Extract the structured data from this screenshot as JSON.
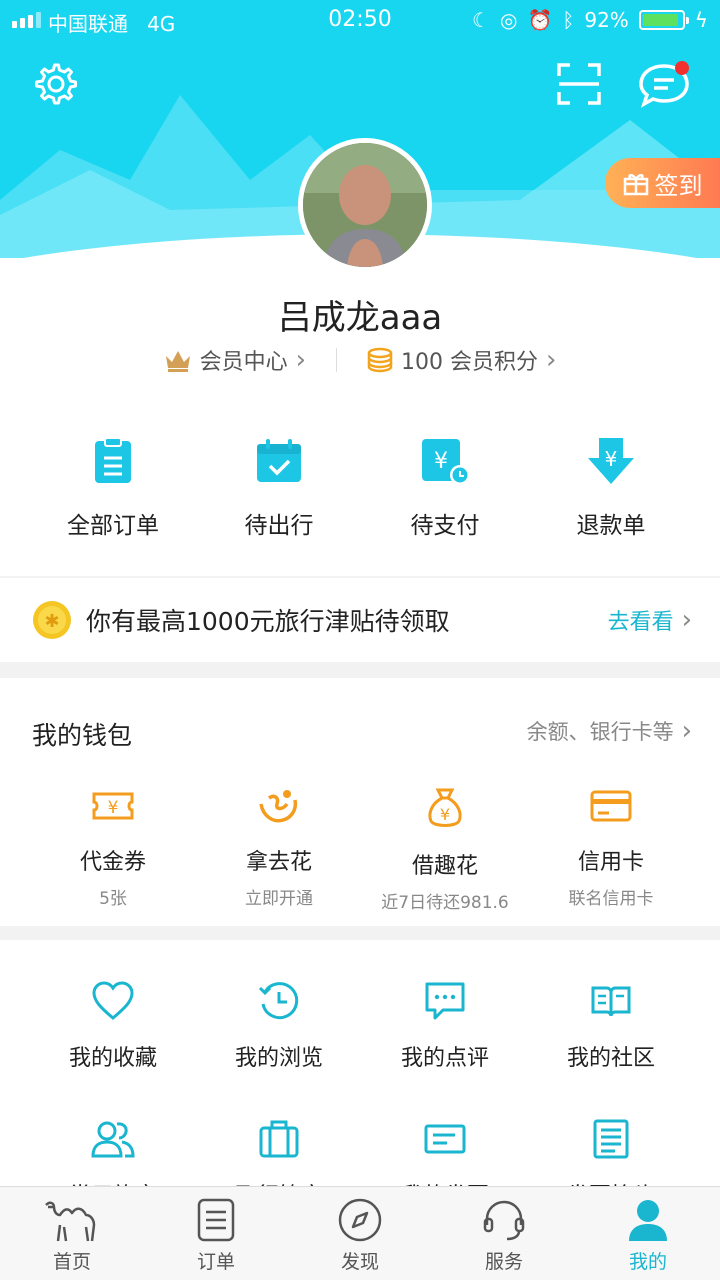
{
  "status_bar": {
    "carrier": "中国联通",
    "network": "4G",
    "time": "02:50",
    "battery": "92%"
  },
  "header": {
    "checkin_label": "签到"
  },
  "profile": {
    "username": "吕成龙aaa",
    "member_center": "会员中心",
    "points": "100 会员积分"
  },
  "orders": [
    {
      "label": "全部订单",
      "icon": "clipboard-icon"
    },
    {
      "label": "待出行",
      "icon": "calendar-check-icon"
    },
    {
      "label": "待支付",
      "icon": "yen-clock-icon"
    },
    {
      "label": "退款单",
      "icon": "refund-arrow-icon"
    }
  ],
  "promo": {
    "text": "你有最高1000元旅行津贴待领取",
    "link": "去看看"
  },
  "wallet": {
    "title": "我的钱包",
    "more": "余额、银行卡等",
    "items": [
      {
        "label": "代金券",
        "sub": "5张",
        "icon": "voucher-icon"
      },
      {
        "label": "拿去花",
        "sub": "立即开通",
        "icon": "nqh-icon"
      },
      {
        "label": "借趣花",
        "sub": "近7日待还981.6",
        "icon": "money-bag-icon"
      },
      {
        "label": "信用卡",
        "sub": "联名信用卡",
        "icon": "credit-card-icon"
      }
    ]
  },
  "services": {
    "row1": [
      {
        "label": "我的收藏",
        "icon": "heart-icon"
      },
      {
        "label": "我的浏览",
        "icon": "history-icon"
      },
      {
        "label": "我的点评",
        "icon": "comment-icon"
      },
      {
        "label": "我的社区",
        "icon": "book-icon"
      }
    ],
    "row2": [
      {
        "label": "常用旅客",
        "icon": "users-icon"
      },
      {
        "label": "飞行管家",
        "icon": "luggage-icon"
      },
      {
        "label": "我的发票",
        "icon": "ticket-icon"
      },
      {
        "label": "发票抬头",
        "icon": "invoice-icon"
      }
    ]
  },
  "tabs": [
    {
      "label": "首页",
      "icon": "camel-icon",
      "active": false
    },
    {
      "label": "订单",
      "icon": "order-list-icon",
      "active": false
    },
    {
      "label": "发现",
      "icon": "compass-icon",
      "active": false
    },
    {
      "label": "服务",
      "icon": "headset-icon",
      "active": false
    },
    {
      "label": "我的",
      "icon": "person-icon",
      "active": true
    }
  ],
  "colors": {
    "header_bg": "#19d6f0",
    "accent": "#1ab6d0",
    "orange": "#f39c1d",
    "checkin_start": "#ffb156",
    "checkin_end": "#ff7a52"
  }
}
